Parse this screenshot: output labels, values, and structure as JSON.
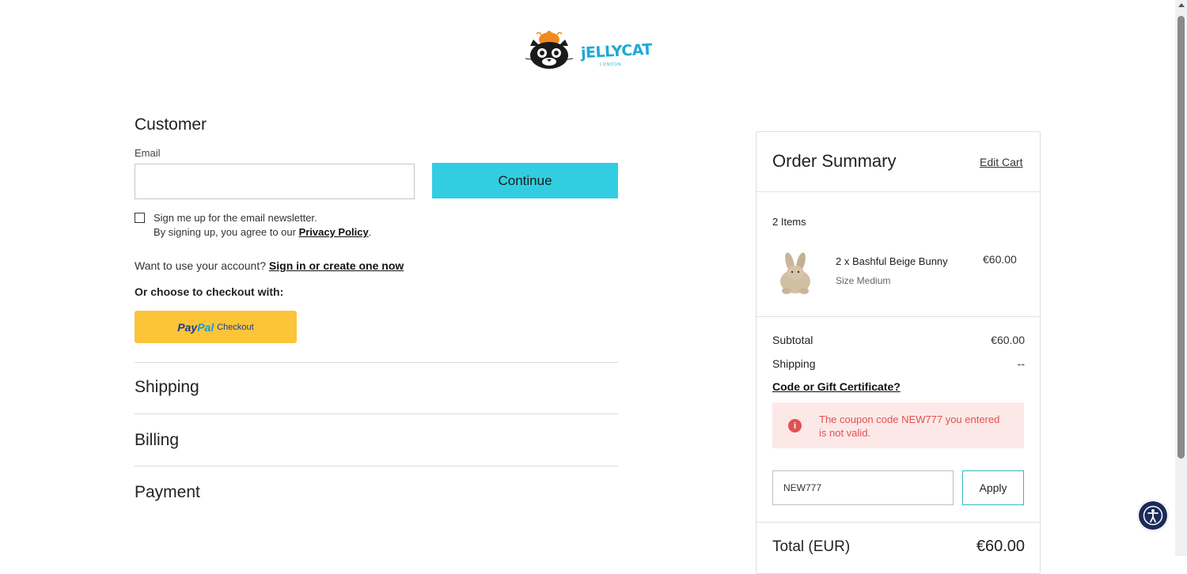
{
  "brand": {
    "name": "jELLYCAT",
    "sub": "LONDON"
  },
  "customer": {
    "title": "Customer",
    "email_label": "Email",
    "email_value": "",
    "continue_label": "Continue",
    "newsletter_label": "Sign me up for the email newsletter.",
    "agree_prefix": "By signing up, you agree to our ",
    "privacy_link": "Privacy Policy",
    "agree_suffix": ".",
    "account_prefix": "Want to use your account? ",
    "signin_link": "Sign in or create one now",
    "choose_label": "Or choose to checkout with:",
    "paypal": {
      "pay": "Pay",
      "pal": "Pal",
      "checkout": "Checkout"
    }
  },
  "steps": {
    "shipping": "Shipping",
    "billing": "Billing",
    "payment": "Payment"
  },
  "summary": {
    "title": "Order Summary",
    "edit_cart": "Edit Cart",
    "items_count": "2 Items",
    "product": {
      "name": "2 x Bashful Beige Bunny",
      "size": "Size Medium",
      "price": "€60.00"
    },
    "subtotal_label": "Subtotal",
    "subtotal_value": "€60.00",
    "shipping_label": "Shipping",
    "shipping_value": "--",
    "coupon_link": "Code or Gift Certificate?",
    "alert_icon": "i",
    "alert_text": "The coupon code NEW777 you entered is not valid.",
    "coupon_value": "NEW777",
    "apply_label": "Apply",
    "total_label": "Total (EUR)",
    "total_value": "€60.00"
  },
  "colors": {
    "accent": "#33cde1",
    "paypal": "#fbc439",
    "error": "#e0524f",
    "error_bg": "#fde8e8"
  }
}
